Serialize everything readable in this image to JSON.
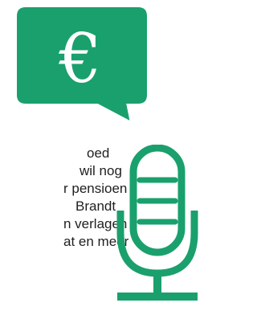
{
  "colors": {
    "accent": "#1aa06d",
    "text": "#1f1f1f"
  },
  "speech_bubble": {
    "symbol": "€"
  },
  "icons": [
    "euro-icon",
    "microphone-icon"
  ],
  "article": {
    "lines": [
      {
        "text": "oed",
        "indent": 108
      },
      {
        "text": "wil nog",
        "indent": 99
      },
      {
        "text": "r pensioen,",
        "indent": 79
      },
      {
        "text": " Brandt",
        "indent": 94
      },
      {
        "text": "n verlagen,",
        "indent": 79
      },
      {
        "text": "at en meer",
        "indent": 79
      },
      {
        "text": "",
        "indent": 79
      }
    ]
  }
}
